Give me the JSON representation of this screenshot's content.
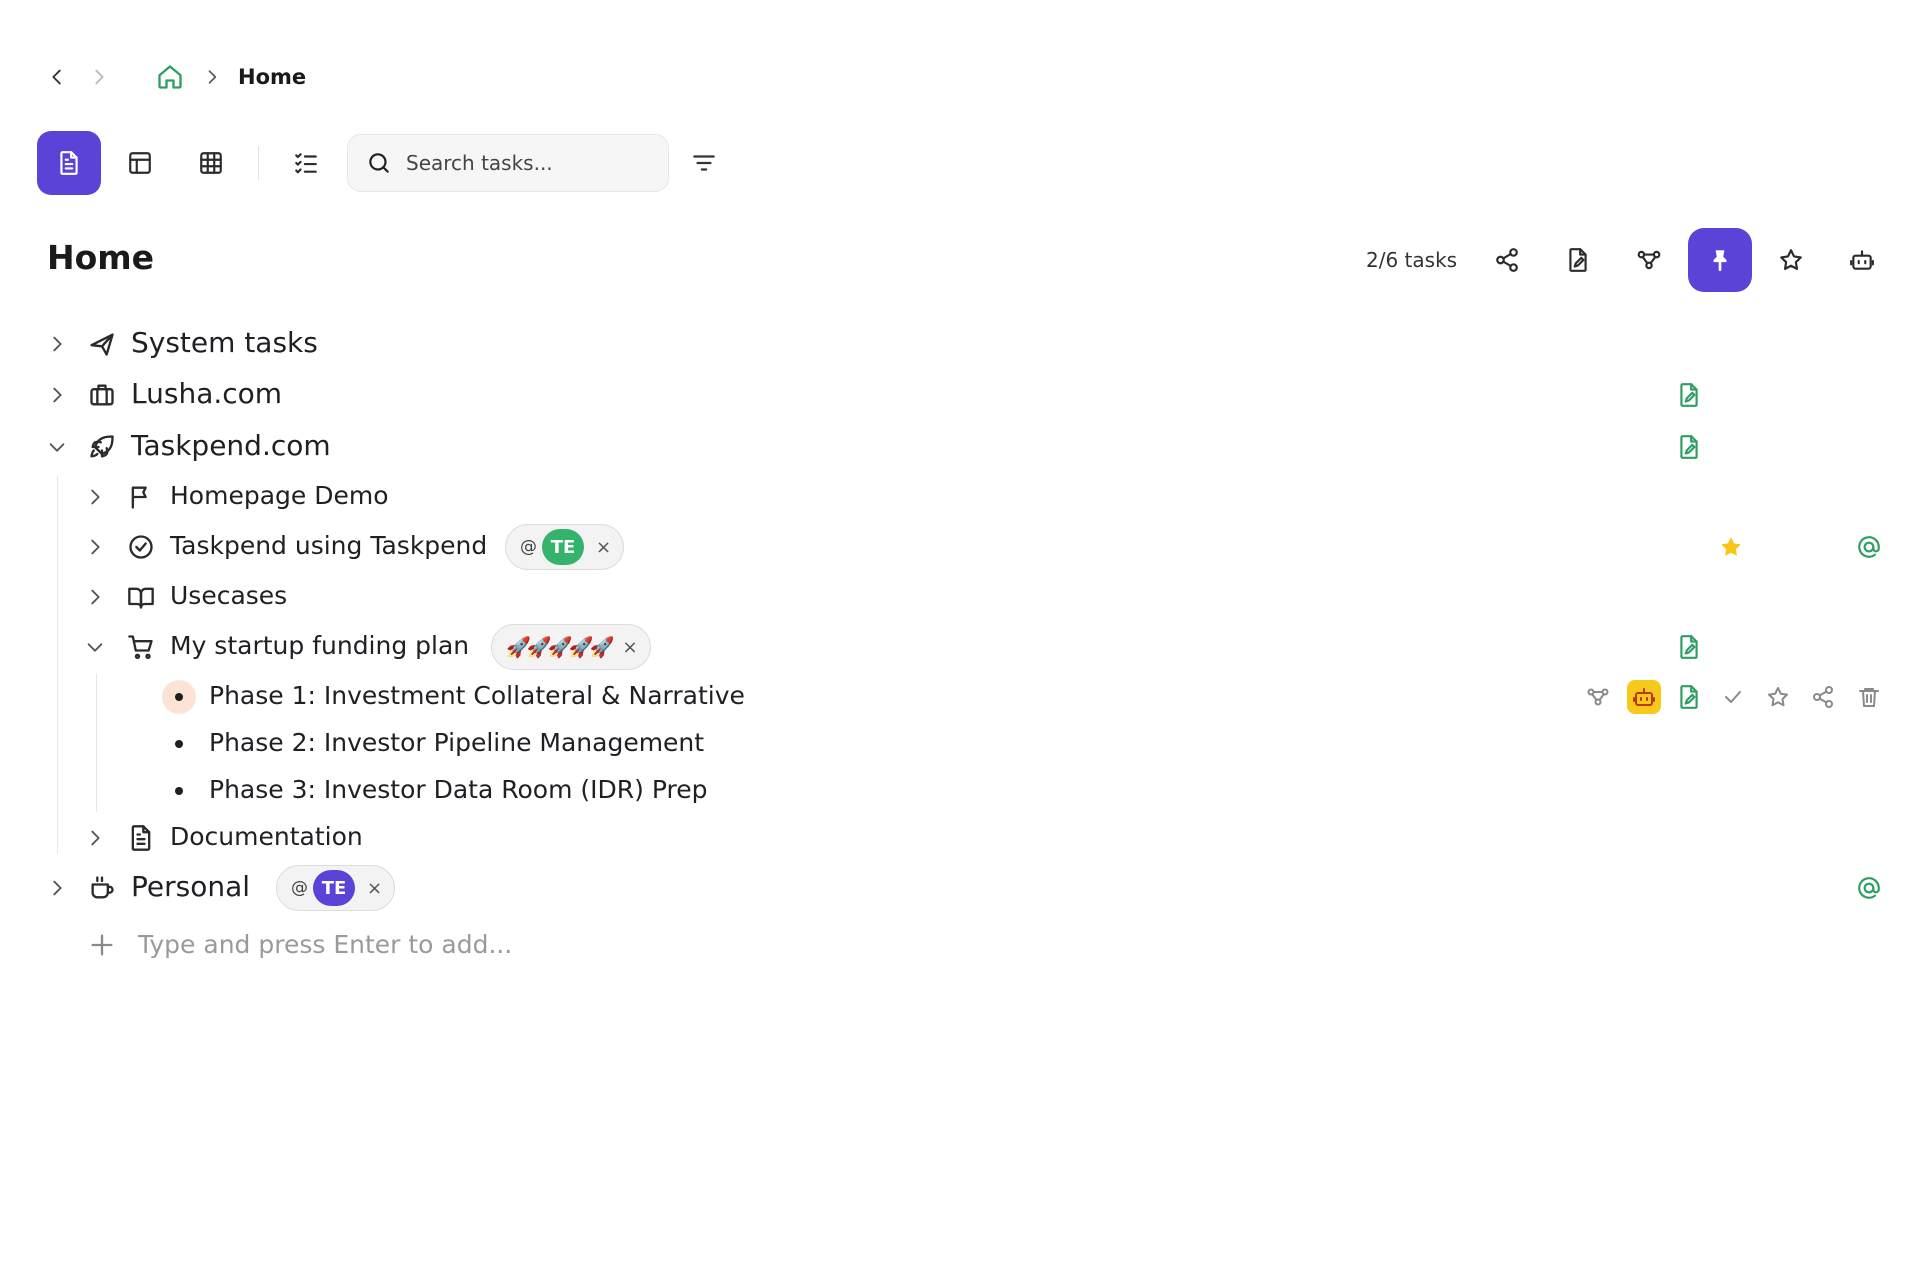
{
  "breadcrumb": {
    "current": "Home"
  },
  "toolbar": {
    "views": [
      "document-view",
      "layout-view",
      "grid-view",
      "checklist-view"
    ],
    "search_placeholder": "Search tasks..."
  },
  "header": {
    "title": "Home",
    "count": "2/6 tasks"
  },
  "tree": {
    "system_tasks": "System tasks",
    "lusha": "Lusha.com",
    "taskpend": "Taskpend.com",
    "homepage_demo": "Homepage Demo",
    "taskpend_using": "Taskpend using Taskpend",
    "usecases": "Usecases",
    "funding_plan": "My startup funding plan",
    "phase1": "Phase 1: Investment Collateral & Narrative",
    "phase2": "Phase 2: Investor Pipeline Management",
    "phase3": "Phase 3: Investor Data Room (IDR) Prep",
    "documentation": "Documentation",
    "personal": "Personal"
  },
  "tags": {
    "taskpend_using": {
      "at": "@",
      "initials": "TE",
      "color": "#33b36b",
      "close": "×"
    },
    "funding_plan": {
      "emojis": "🚀🚀🚀🚀🚀",
      "close": "×"
    },
    "personal": {
      "at": "@",
      "initials": "TE",
      "color": "#5a43d6",
      "close": "×"
    }
  },
  "add": {
    "placeholder": "Type and press Enter to add..."
  },
  "colors": {
    "accent": "#5a43d6",
    "green": "#2e9e62",
    "star": "#f5c518"
  }
}
